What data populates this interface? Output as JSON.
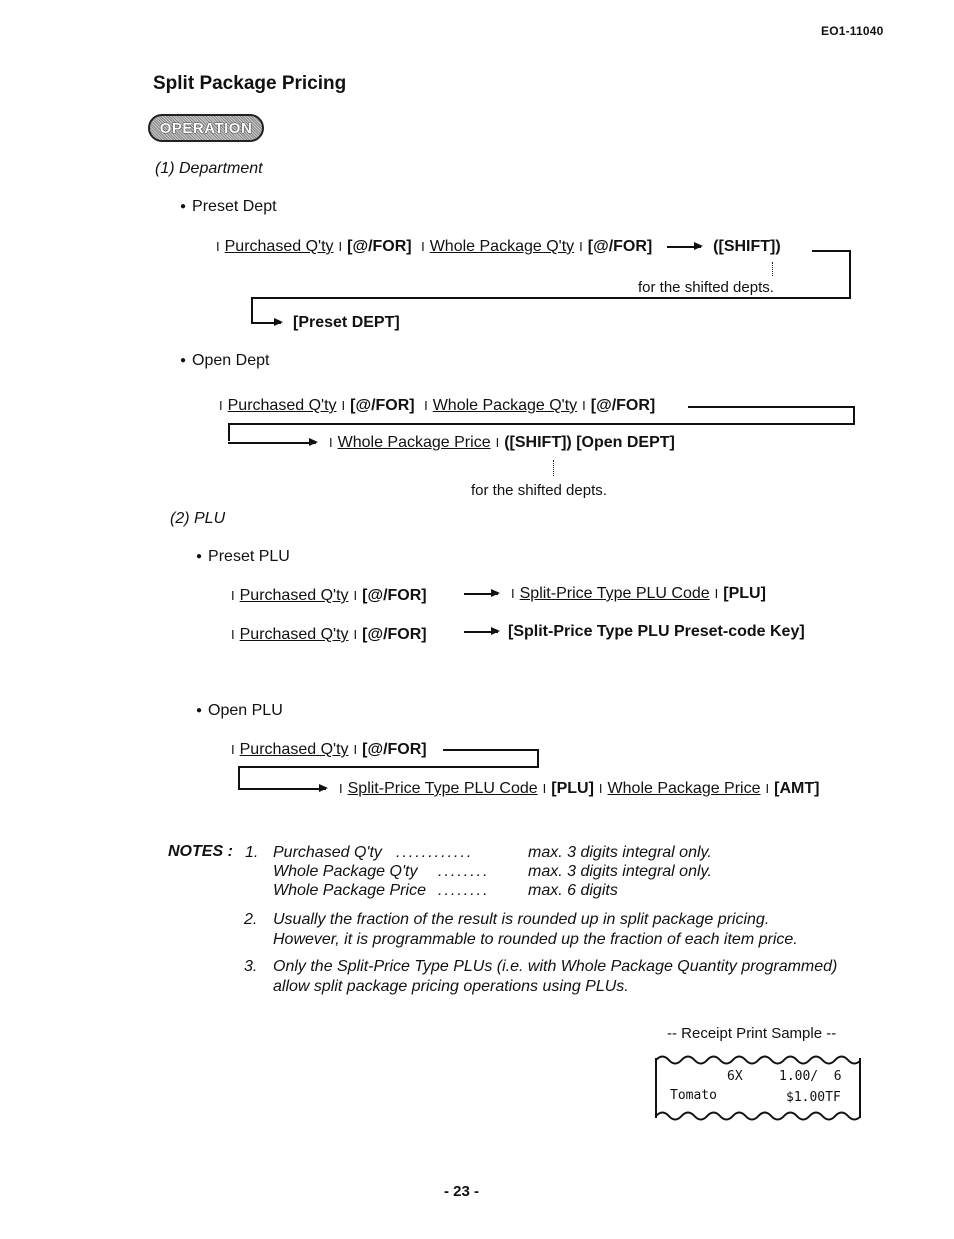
{
  "header": {
    "doc_number": "EO1-11040"
  },
  "title": "Split Package Pricing",
  "badge": "OPERATION",
  "sections": {
    "department": {
      "heading": "(1)  Department",
      "preset": {
        "bullet": "Preset Dept",
        "seq1": [
          "Purchased Q'ty",
          "[@/FOR]",
          "Whole Package Q'ty",
          "[@/FOR]"
        ],
        "shift": "([SHIFT])",
        "shift_note": "for the shifted depts.",
        "final_key": "[Preset DEPT]"
      },
      "open": {
        "bullet": "Open Dept",
        "seq1": [
          "Purchased Q'ty",
          "[@/FOR]",
          "Whole Package Q'ty",
          "[@/FOR]"
        ],
        "seq2_price": "Whole Package Price",
        "seq2_keys": "([SHIFT]) [Open DEPT]",
        "shift_note": "for the shifted depts."
      }
    },
    "plu": {
      "heading": "(2)  PLU",
      "preset": {
        "bullet": "Preset PLU",
        "row1": {
          "qty": "Purchased Q'ty",
          "for": "[@/FOR]",
          "code": "Split-Price Type PLU Code",
          "key": "[PLU]"
        },
        "row2": {
          "qty": "Purchased Q'ty",
          "for": "[@/FOR]",
          "key": "[Split-Price Type PLU Preset-code Key]"
        }
      },
      "open": {
        "bullet": "Open PLU",
        "qty": "Purchased Q'ty",
        "for": "[@/FOR]",
        "code": "Split-Price Type PLU Code",
        "plu_key": "[PLU]",
        "price": "Whole Package Price",
        "amt_key": "[AMT]"
      }
    }
  },
  "notes": {
    "label": "NOTES :",
    "items": [
      {
        "num": "1.",
        "rows": [
          {
            "field": "Purchased Q'ty",
            "leader": "............",
            "limit": "max. 3 digits integral only."
          },
          {
            "field": "Whole Package Q'ty",
            "leader": "........",
            "limit": "max. 3 digits integral only."
          },
          {
            "field": "Whole Package Price",
            "leader": "........",
            "limit": "max. 6 digits"
          }
        ]
      },
      {
        "num": "2.",
        "lines": [
          "Usually the fraction of the result is rounded up in split package pricing.",
          "However, it is programmable to rounded up the fraction of each item price."
        ]
      },
      {
        "num": "3.",
        "lines": [
          "Only the Split-Price Type PLUs (i.e. with Whole Package Quantity programmed)",
          "allow split package pricing operations using PLUs."
        ]
      }
    ]
  },
  "receipt": {
    "title": "-- Receipt Print Sample --",
    "line1_qty": "6X",
    "line1_price": "1.00/  6",
    "line2_item": "Tomato",
    "line2_amount": "$1.00TF"
  },
  "footer": {
    "page": "- 23 -"
  }
}
